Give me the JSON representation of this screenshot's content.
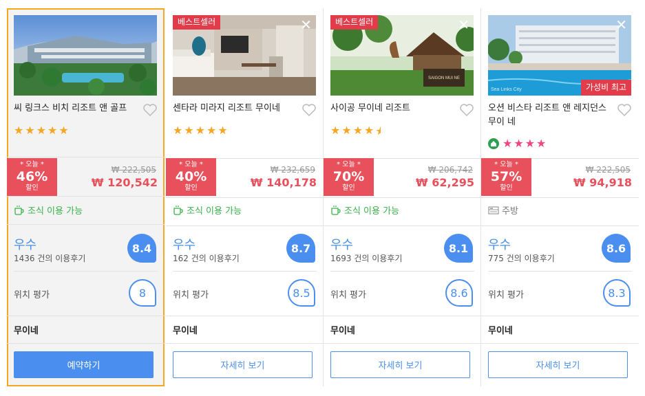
{
  "hotels": [
    {
      "name": "씨 링크스 비치 리조트 앤 골프",
      "badge": "",
      "value_badge": "",
      "stars": 5,
      "discount_label": "* 오늘 *",
      "discount_pct": "46%",
      "discount_sub": "할인",
      "original_price": "₩ 222,505",
      "price": "₩ 120,542",
      "amenity": "조식 이용 가능",
      "rating_label": "우수",
      "reviews": "1436 건의 이용후기",
      "score": "8.4",
      "location_label": "위치 평가",
      "location_score": "8",
      "area": "무이네",
      "button": "예약하기"
    },
    {
      "name": "센타라 미라지 리조트 무이네",
      "badge": "베스트셀러",
      "value_badge": "",
      "stars": 5,
      "discount_label": "* 오늘 *",
      "discount_pct": "40%",
      "discount_sub": "할인",
      "original_price": "₩ 232,659",
      "price": "₩ 140,178",
      "amenity": "조식 이용 가능",
      "rating_label": "우수",
      "reviews": "162 건의 이용후기",
      "score": "8.7",
      "location_label": "위치 평가",
      "location_score": "8.5",
      "area": "무이네",
      "button": "자세히 보기"
    },
    {
      "name": "사이공 무이네 리조트",
      "badge": "베스트셀러",
      "value_badge": "",
      "stars": 4.5,
      "photo_sign": "SAIGON MUI NE",
      "discount_label": "* 오늘 *",
      "discount_pct": "70%",
      "discount_sub": "할인",
      "original_price": "₩ 206,742",
      "price": "₩ 62,295",
      "amenity": "조식 이용 가능",
      "rating_label": "우수",
      "reviews": "1693 건의 이용후기",
      "score": "8.1",
      "location_label": "위치 평가",
      "location_score": "8.6",
      "area": "무이네",
      "button": "자세히 보기"
    },
    {
      "name": "오션 비스타 리조트 앤 레지던스 무이 네",
      "badge": "",
      "value_badge": "가성비 최고",
      "stars": 4,
      "photo_watermark": "Sea Links City",
      "discount_label": "* 오늘 *",
      "discount_pct": "57%",
      "discount_sub": "할인",
      "original_price": "₩ 222,505",
      "price": "₩ 94,918",
      "amenity": "주방",
      "rating_label": "우수",
      "reviews": "775 건의 이용후기",
      "score": "8.6",
      "location_label": "위치 평가",
      "location_score": "8.3",
      "area": "무이네",
      "button": "자세히 보기"
    }
  ],
  "colors": {
    "selected_border": "#f5a623",
    "discount_bg": "#e8505b",
    "price": "#e8505b",
    "accent_blue": "#4a8ef0",
    "star": "#f5a623",
    "star_pink": "#ef4680",
    "amenity_green": "#38b24a",
    "badge_red": "#e23b4a"
  },
  "icons": {
    "heart": "heart-outline-icon",
    "breakfast": "coffee-cup-icon",
    "kitchen": "kitchen-icon",
    "close": "close-icon",
    "home": "home-icon"
  }
}
